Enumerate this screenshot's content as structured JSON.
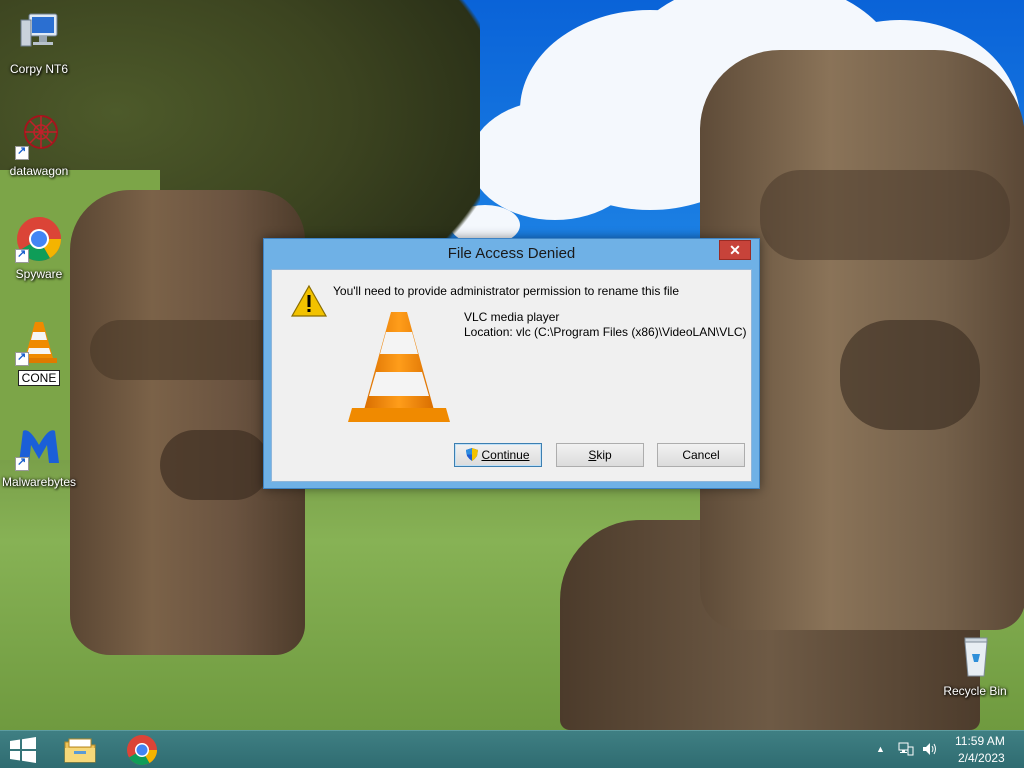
{
  "desktop": {
    "icons": [
      {
        "label": "Corpy NT6",
        "icon": "computer-icon"
      },
      {
        "label": "datawagon",
        "icon": "datawagon-icon"
      },
      {
        "label": "Spyware",
        "icon": "chrome-icon"
      },
      {
        "label": "CONE",
        "icon": "vlc-icon"
      },
      {
        "label": "Malwarebytes",
        "icon": "malwarebytes-icon"
      },
      {
        "label": "Recycle Bin",
        "icon": "recycle-bin-icon"
      }
    ]
  },
  "dialog": {
    "title": "File Access Denied",
    "close_glyph": "✕",
    "message": "You'll need to provide administrator permission to rename this file",
    "app_name": "VLC media player",
    "location": "Location: vlc (C:\\Program Files (x86)\\VideoLAN\\VLC)",
    "buttons": {
      "continue_underline": "C",
      "continue_rest": "ontinue",
      "skip_underline": "S",
      "skip_rest": "kip",
      "cancel": "Cancel"
    },
    "colors": {
      "warning": "#f2c200",
      "cone_orange": "#f08a00",
      "close": "#c7433a"
    }
  },
  "taskbar": {
    "apps": [
      "file-explorer-icon",
      "chrome-icon"
    ],
    "tray": {
      "up_arrow": "▲",
      "time": "11:59 AM",
      "date": "2/4/2023"
    },
    "color": "#2f6c71"
  }
}
